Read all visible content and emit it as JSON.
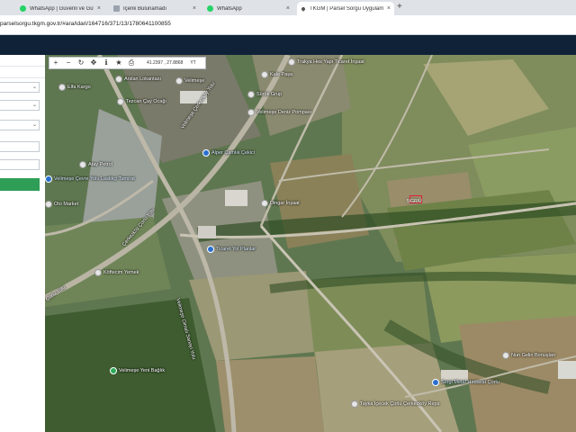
{
  "browser": {
    "tabs": [
      {
        "label": "WhatsApp | Güvenli ve Güvenilir",
        "icon": "whatsapp-icon",
        "active": false
      },
      {
        "label": "İçerik Bulunamadı",
        "icon": "page-icon",
        "active": false
      },
      {
        "label": "WhatsApp",
        "icon": "whatsapp-icon",
        "active": false
      },
      {
        "label": "TKGM | Parsel Sorgu Uygulaması",
        "icon": "map-pin-icon",
        "active": true
      }
    ],
    "new_tab_label": "+",
    "close_label": "×",
    "address": "parselsorgu.tkgm.gov.tr/#ara/idari/164716/371/13/1780641100855"
  },
  "map": {
    "toolbar": {
      "buttons": [
        "+",
        "−",
        "↻",
        "✥",
        "ℹ",
        "★",
        "⎙"
      ],
      "coordinates": "41.2397 , 27.8868",
      "last_label": "ΥΤ"
    },
    "parcel_label": "5/GR/Ü",
    "pois": [
      {
        "label": "Trakya Hes Yapı Ticaret İnşaat",
        "color": "gray"
      },
      {
        "label": "Kale Paşa",
        "color": "gray"
      },
      {
        "label": "Sürük Grup",
        "color": "gray"
      },
      {
        "label": "Arslan Lokantası",
        "color": "gray"
      },
      {
        "label": "Velimeşe",
        "color": "gray"
      },
      {
        "label": "Elfa Kargo",
        "color": "gray"
      },
      {
        "label": "Tezcan Çay Ocağı",
        "color": "gray"
      },
      {
        "label": "Velimeşe Deniz Pompası",
        "color": "gray"
      },
      {
        "label": "Alper Çamlık Çekici",
        "color": "blue"
      },
      {
        "label": "Atay Petrol",
        "color": "gray"
      },
      {
        "label": "Velimeşe Çevre Yolu Lastikçi Tamirat",
        "color": "blue"
      },
      {
        "label": "Oto Market",
        "color": "gray"
      },
      {
        "label": "Dingar İnşaat",
        "color": "gray"
      },
      {
        "label": "Ticaret Yol Planlar",
        "color": "blue"
      },
      {
        "label": "Köftecim Yemek",
        "color": "gray"
      },
      {
        "label": "Velimeşe Yeni Bağlık",
        "color": "green"
      },
      {
        "label": "Sergi Metal Hırdavat Çorlu",
        "color": "blue"
      },
      {
        "label": "Tayka İçecek Çorlu Çerkezköy Reps",
        "color": "gray"
      },
      {
        "label": "Nun Gelin Bonuşları",
        "color": "gray"
      }
    ],
    "roads": [
      "Velimeşe Çerkezköy Yolu",
      "Çerkezköy Çorlu Yolu",
      "Çorlu Yolu",
      "Velimeşe Olmalı Sanayi Yolu"
    ]
  }
}
